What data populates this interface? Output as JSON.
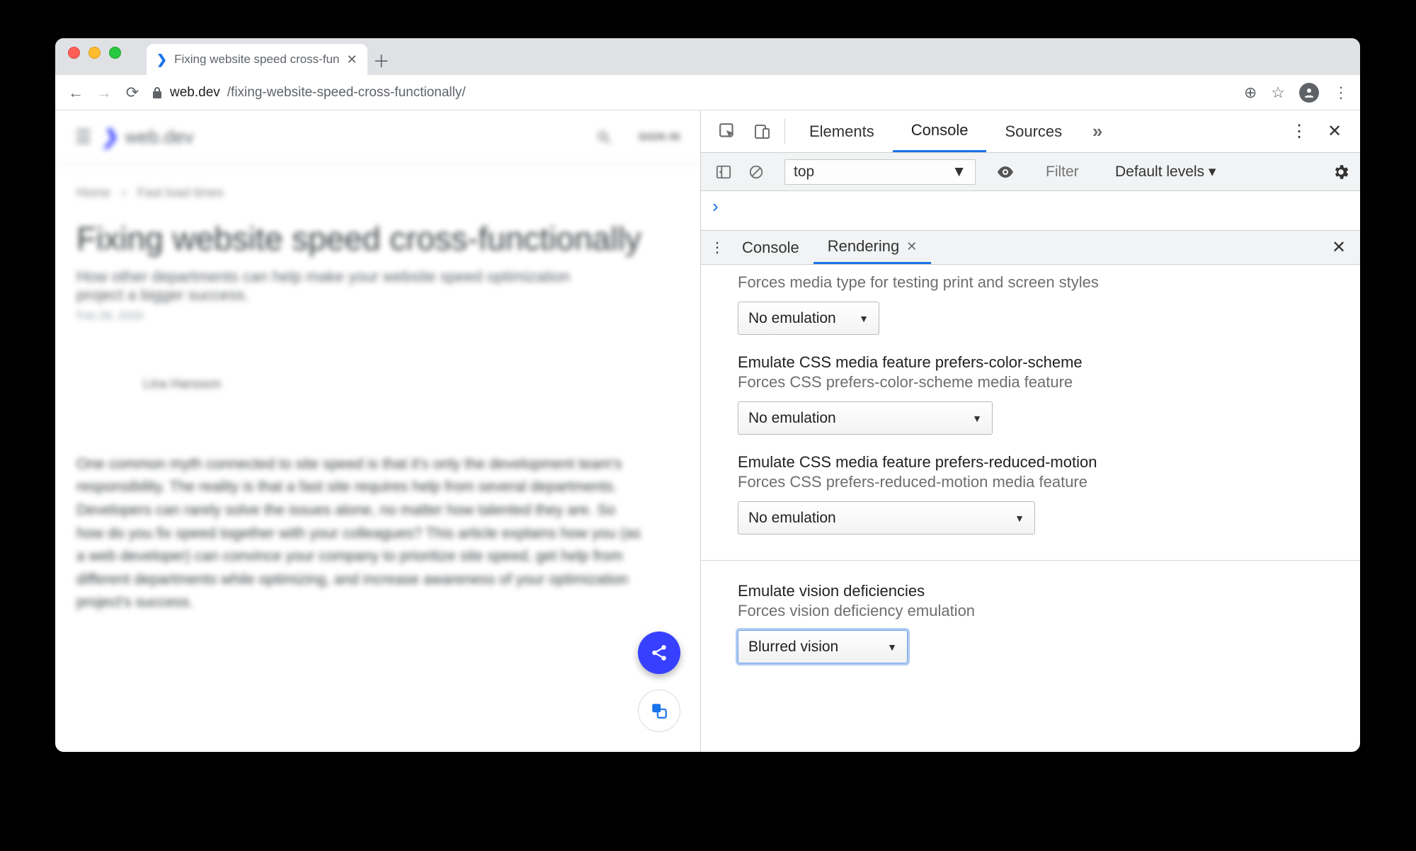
{
  "browser": {
    "tab_title": "Fixing website speed cross-fun",
    "url_host": "web.dev",
    "url_path": "/fixing-website-speed-cross-functionally/"
  },
  "page": {
    "site_name": "web.dev",
    "signin": "SIGN IN",
    "breadcrumbs": [
      "Home",
      "Fast load times"
    ],
    "title": "Fixing website speed cross-functionally",
    "subtitle": "How other departments can help make your website speed optimization project a bigger success.",
    "date": "Feb 28, 2020",
    "author": "Lina Hansson",
    "paragraph": "One common myth connected to site speed is that it's only the development team's responsibility. The reality is that a fast site requires help from several departments. Developers can rarely solve the issues alone, no matter how talented they are. So how do you fix speed together with your colleagues? This article explains how you (as a web developer) can convince your company to prioritize site speed, get help from different departments while optimizing, and increase awareness of your optimization project's success."
  },
  "devtools": {
    "tabs": [
      "Elements",
      "Console",
      "Sources"
    ],
    "active_tab": "Console",
    "context": "top",
    "filter_placeholder": "Filter",
    "levels": "Default levels ▾",
    "console_prompt": "›",
    "drawer_tabs": [
      "Console",
      "Rendering"
    ],
    "drawer_active": "Rendering",
    "sections": {
      "media_type_desc": "Forces media type for testing print and screen styles",
      "media_type_value": "No emulation",
      "pcs_title": "Emulate CSS media feature prefers-color-scheme",
      "pcs_desc": "Forces CSS prefers-color-scheme media feature",
      "pcs_value": "No emulation",
      "prm_title": "Emulate CSS media feature prefers-reduced-motion",
      "prm_desc": "Forces CSS prefers-reduced-motion media feature",
      "prm_value": "No emulation",
      "vd_title": "Emulate vision deficiencies",
      "vd_desc": "Forces vision deficiency emulation",
      "vd_value": "Blurred vision"
    }
  }
}
